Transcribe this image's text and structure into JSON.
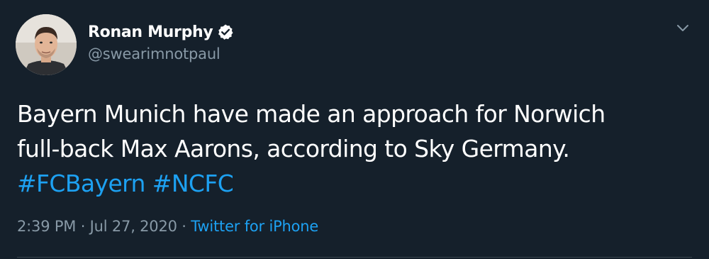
{
  "author": {
    "display_name": "Ronan Murphy",
    "handle": "@swearimnotpaul",
    "verified": true,
    "avatar_icon": "profile-photo"
  },
  "tweet": {
    "line1": "Bayern Munich have made an approach for Norwich",
    "line2": "full-back Max Aarons, according to Sky Germany.",
    "hashtags": [
      "#FCBayern",
      "#NCFC"
    ]
  },
  "meta": {
    "time": "2:39 PM",
    "sep1": " · ",
    "date": "Jul 27, 2020",
    "sep2": " · ",
    "source": "Twitter for iPhone"
  },
  "colors": {
    "background": "#15202b",
    "text": "#ffffff",
    "secondary": "#8899a6",
    "accent": "#1da1f2",
    "divider": "#38444d"
  },
  "icons": {
    "verified": "verified-badge-icon",
    "menu": "chevron-down-icon"
  }
}
